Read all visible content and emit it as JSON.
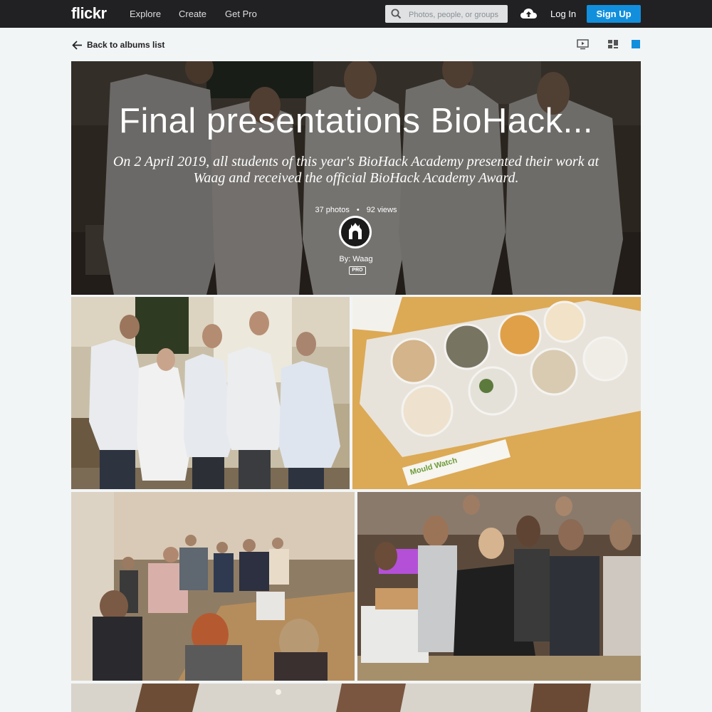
{
  "nav": {
    "logo": "flickr",
    "links": [
      "Explore",
      "Create",
      "Get Pro"
    ],
    "search_placeholder": "Photos, people, or groups",
    "login": "Log In",
    "signup": "Sign Up"
  },
  "subbar": {
    "back_label": "Back to albums list"
  },
  "album": {
    "title": "Final presentations BioHack...",
    "description": "On 2 April 2019, all students of this year's BioHack Academy presented their work at Waag and received the official BioHack Academy Award.",
    "photo_count": "37 photos",
    "view_count": "92 views",
    "owner": "By: Waag",
    "owner_badge": "PRO"
  },
  "photos": [
    {
      "name": "group-portrait-photo"
    },
    {
      "name": "petri-dishes-photo",
      "caption": "Mould Watch"
    },
    {
      "name": "workshop-crowd-photo"
    },
    {
      "name": "presentation-demo-photo"
    },
    {
      "name": "ceiling-photo"
    }
  ],
  "colors": {
    "topbar": "#212124",
    "accent": "#128fdc",
    "page_bg": "#f2f5f6"
  }
}
